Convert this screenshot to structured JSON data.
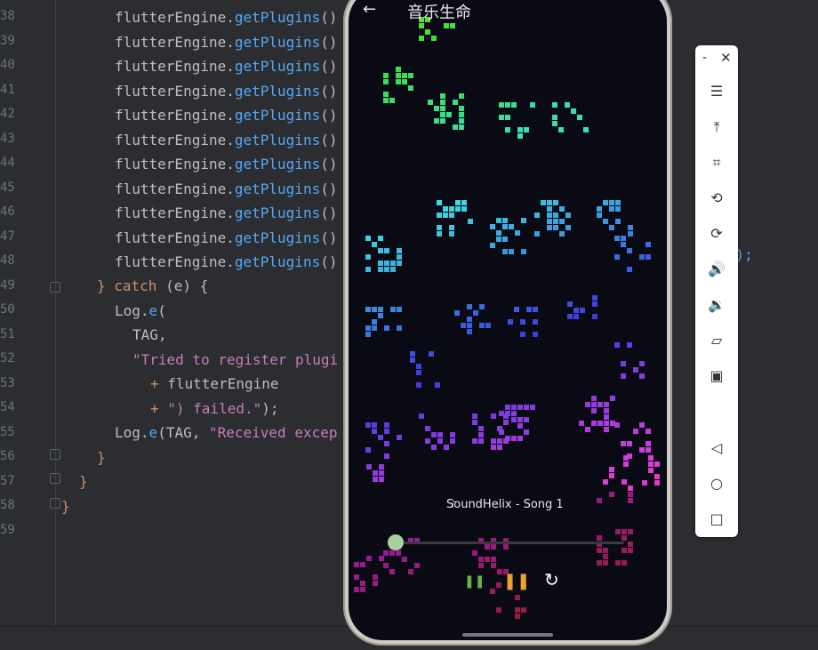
{
  "editor": {
    "line_numbers": [
      "38",
      "39",
      "40",
      "41",
      "42",
      "43",
      "44",
      "45",
      "46",
      "47",
      "48",
      "49",
      "50",
      "51",
      "52",
      "53",
      "54",
      "55",
      "56",
      "57",
      "58",
      "59"
    ],
    "lines": [
      {
        "indent": "      ",
        "a": "flutterEngine",
        "b": ".",
        "c": "getPlugins",
        "d": "()"
      },
      {
        "indent": "      ",
        "a": "flutterEngine",
        "b": ".",
        "c": "getPlugins",
        "d": "()"
      },
      {
        "indent": "      ",
        "a": "flutterEngine",
        "b": ".",
        "c": "getPlugins",
        "d": "()"
      },
      {
        "indent": "      ",
        "a": "flutterEngine",
        "b": ".",
        "c": "getPlugins",
        "d": "()"
      },
      {
        "indent": "      ",
        "a": "flutterEngine",
        "b": ".",
        "c": "getPlugins",
        "d": "()"
      },
      {
        "indent": "      ",
        "a": "flutterEngine",
        "b": ".",
        "c": "getPlugins",
        "d": "()"
      },
      {
        "indent": "      ",
        "a": "flutterEngine",
        "b": ".",
        "c": "getPlugins",
        "d": "()"
      },
      {
        "indent": "      ",
        "a": "flutterEngine",
        "b": ".",
        "c": "getPlugins",
        "d": "()"
      },
      {
        "indent": "      ",
        "a": "flutterEngine",
        "b": ".",
        "c": "getPlugins",
        "d": "()"
      },
      {
        "indent": "      ",
        "a": "flutterEngine",
        "b": ".",
        "c": "getPlugins",
        "d": "()"
      },
      {
        "indent": "      ",
        "a": "flutterEngine",
        "b": ".",
        "c": "getPlugins",
        "d": "()"
      }
    ],
    "catch_line": {
      "brace": "} ",
      "kw": "catch",
      "rest": " (e) {"
    },
    "log_e1": {
      "a": "Log",
      "b": ".",
      "c": "e",
      "d": "("
    },
    "tag_line": "TAG,",
    "str_line": "\"Tried to register plugi",
    "plus1": {
      "op": "+ ",
      "text": "flutterEngine"
    },
    "plus2": {
      "op": "+ ",
      "str": "\") failed.\"",
      "end": ");"
    },
    "log_e2": {
      "a": "Log",
      "b": ".",
      "c": "e",
      "d": "(TAG, ",
      "s": "\"Received excep"
    },
    "close1": "}",
    "close2": "}",
    "close3": "}",
    "right_frag1": "lue);",
    "right_frag2": ";"
  },
  "app": {
    "title": "音乐生命",
    "back_icon": "arrow-left-icon",
    "song": "SoundHelix - Song 1",
    "progress": 0.0,
    "pause_label": "❚❚",
    "refresh_label": "↻"
  },
  "toolbar": {
    "min_label": "-",
    "close_label": "✕",
    "items": [
      {
        "name": "menu-icon",
        "glyph": "☰"
      },
      {
        "name": "pin-top-icon",
        "glyph": "⤒"
      },
      {
        "name": "crop-icon",
        "glyph": "⌗"
      },
      {
        "name": "rotate-left-icon",
        "glyph": "⟲"
      },
      {
        "name": "rotate-right-icon",
        "glyph": "⟳"
      },
      {
        "name": "volume-up-icon",
        "glyph": "🔊"
      },
      {
        "name": "volume-down-icon",
        "glyph": "🔉"
      },
      {
        "name": "shake-icon",
        "glyph": "▱"
      },
      {
        "name": "screenshot-icon",
        "glyph": "▣"
      },
      {
        "name": "back-nav-icon",
        "glyph": "◁"
      },
      {
        "name": "home-nav-icon",
        "glyph": "○"
      },
      {
        "name": "recents-nav-icon",
        "glyph": "□"
      }
    ]
  },
  "colors": {
    "editor_bg": "#2b2d30",
    "phone_bg": "#0a0a14",
    "accent_pause": "#f0a030",
    "accent_play": "#6ab04c"
  }
}
